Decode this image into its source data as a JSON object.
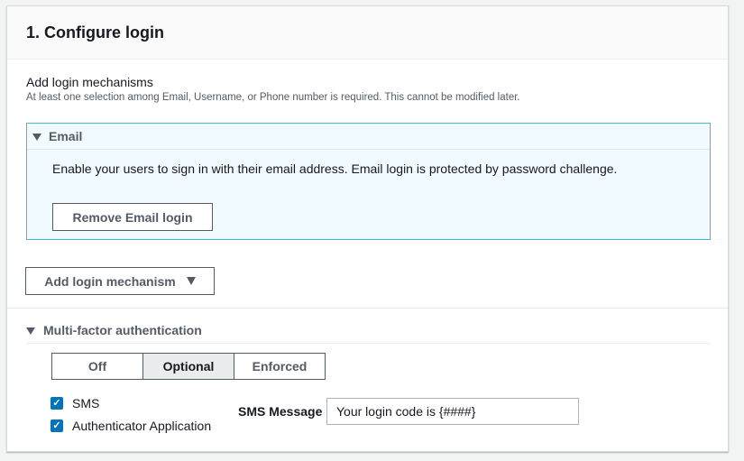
{
  "panel": {
    "title": "1. Configure login"
  },
  "login_mechanisms": {
    "label": "Add login mechanisms",
    "description": "At least one selection among Email, Username, or Phone number is required. This cannot be modified later."
  },
  "email": {
    "title": "Email",
    "text": "Enable your users to sign in with their email address. Email login is protected by password challenge.",
    "remove_label": "Remove Email login"
  },
  "add_mechanism": {
    "label": "Add login mechanism",
    "icon": "caret-down-icon"
  },
  "mfa": {
    "title": "Multi-factor authentication",
    "options": [
      "Off",
      "Optional",
      "Enforced"
    ],
    "selected": "Optional",
    "checkboxes": [
      {
        "label": "SMS",
        "checked": true
      },
      {
        "label": "Authenticator Application",
        "checked": true
      }
    ],
    "sms_message_label": "SMS Message",
    "sms_message_value": "Your login code is {####}"
  },
  "colors": {
    "accent": "#0073bb",
    "info_border": "#44b9d6",
    "info_bg": "#f1faff"
  }
}
